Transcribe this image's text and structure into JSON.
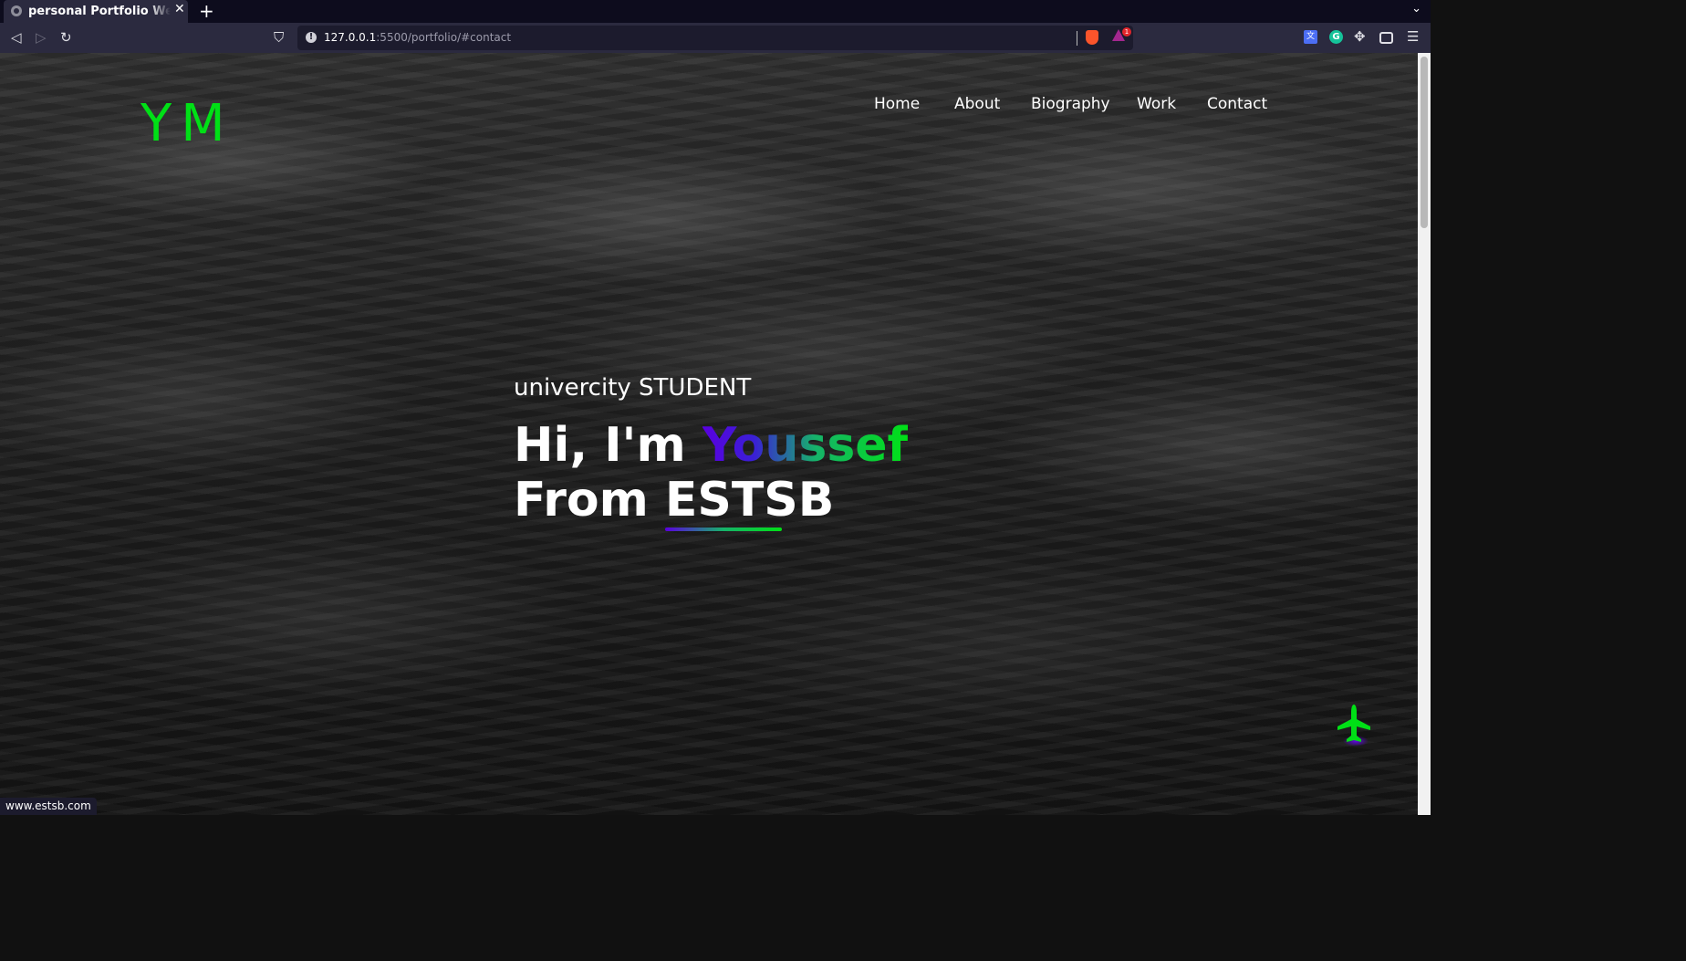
{
  "browser": {
    "tab_title": "personal Portfolio Website",
    "tab_close": "✕",
    "new_tab": "+",
    "tabs_menu": "⌄",
    "url_host": "127.0.0.1",
    "url_path": ":5500/portfolio/#contact",
    "rewards_badge": "1",
    "status_url": "www.estsb.com",
    "icons": {
      "back": "◁",
      "forward": "▷",
      "reload": "↻",
      "bookmark": "⛉",
      "site_info": "!",
      "extensions": "✥",
      "menu": "☰"
    }
  },
  "page": {
    "logo": "YM",
    "nav": [
      "Home",
      "About",
      "Biography",
      "Work",
      "Contact"
    ],
    "subtitle": "univercity STUDENT",
    "headline_prefix": "Hi, I'm ",
    "headline_name": "Youssef",
    "headline_from": "From ",
    "headline_school": "ESTSB"
  },
  "colors": {
    "accent_green": "#00e016",
    "accent_purple": "#5a00e0"
  }
}
